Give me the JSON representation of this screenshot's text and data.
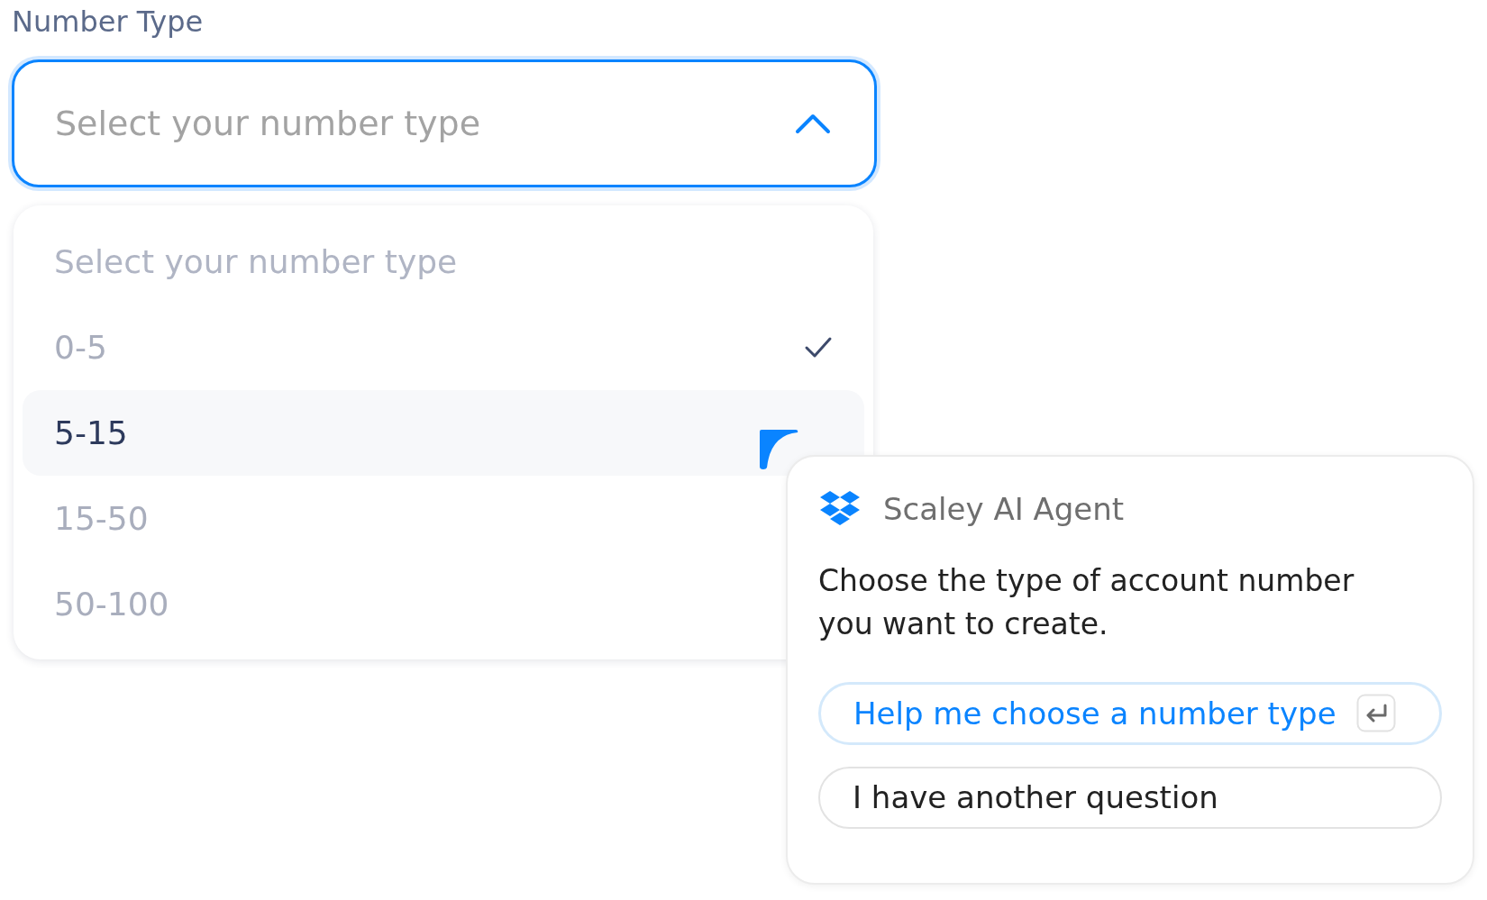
{
  "field": {
    "label": "Number Type",
    "placeholder": "Select your number type",
    "expanded": true
  },
  "dropdown": {
    "placeholder_option": "Select your number type",
    "options": [
      {
        "label": "0-5",
        "selected": true,
        "highlighted": false
      },
      {
        "label": "5-15",
        "selected": false,
        "highlighted": true
      },
      {
        "label": "15-50",
        "selected": false,
        "highlighted": false
      },
      {
        "label": "50-100",
        "selected": false,
        "highlighted": false
      }
    ]
  },
  "agent": {
    "name": "Scaley AI Agent",
    "message": "Choose the type of account number you want to create.",
    "actions": [
      {
        "label": "Help me choose a number type",
        "primary": true
      },
      {
        "label": "I have another question",
        "primary": false
      }
    ]
  }
}
